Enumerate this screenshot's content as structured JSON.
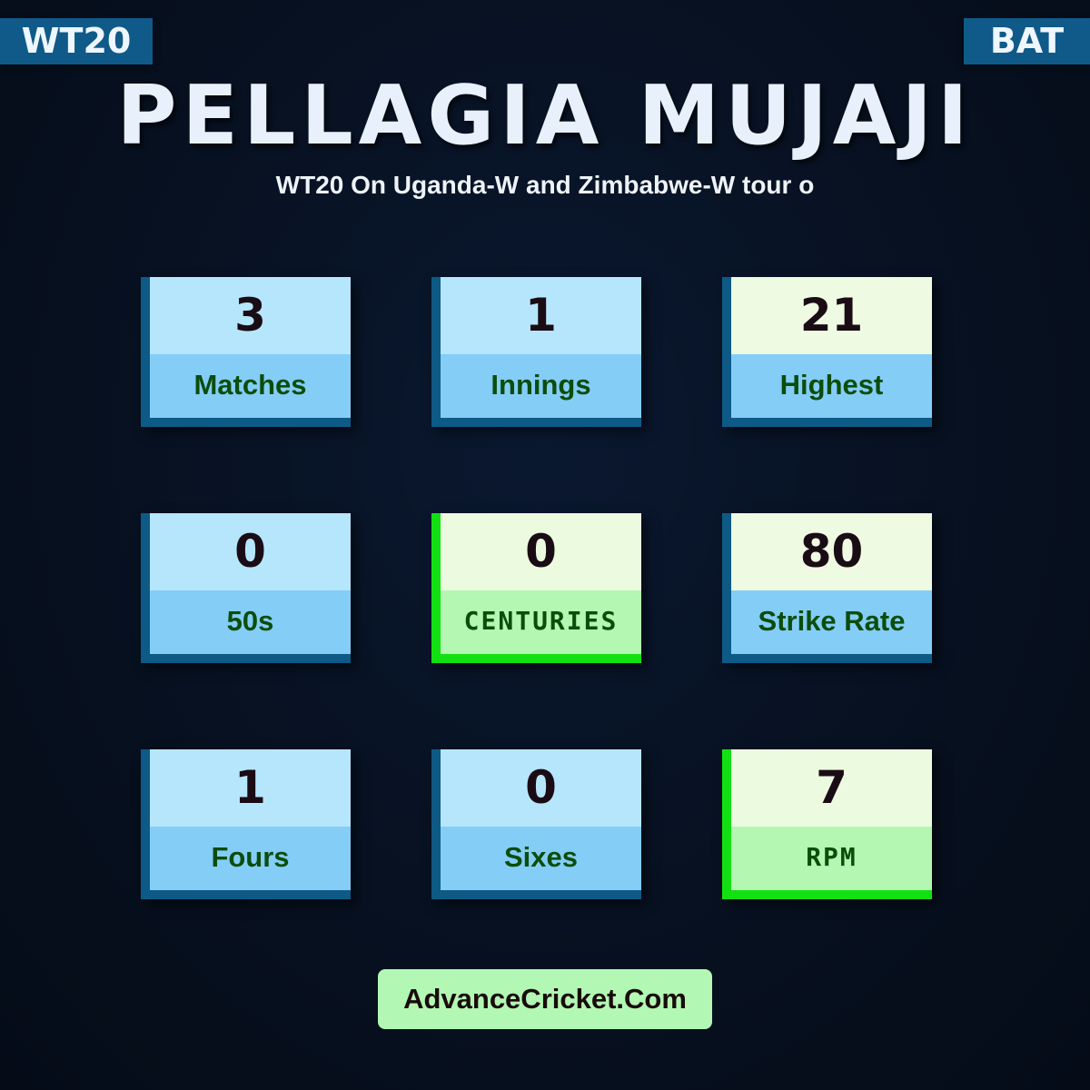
{
  "header": {
    "format_tag": "WT20",
    "role_tag": "BAT",
    "player_name": "PELLAGIA MUJAJI",
    "subtitle": "WT20 On Uganda-W and Zimbabwe-W tour o"
  },
  "stats": [
    {
      "value": "3",
      "label": "Matches",
      "style": "blue"
    },
    {
      "value": "1",
      "label": "Innings",
      "style": "blue"
    },
    {
      "value": "21",
      "label": "Highest",
      "style": "cream"
    },
    {
      "value": "0",
      "label": "50s",
      "style": "blue"
    },
    {
      "value": "0",
      "label": "CENTURIES",
      "style": "green"
    },
    {
      "value": "80",
      "label": "Strike Rate",
      "style": "cream"
    },
    {
      "value": "1",
      "label": "Fours",
      "style": "blue"
    },
    {
      "value": "0",
      "label": "Sixes",
      "style": "blue"
    },
    {
      "value": "7",
      "label": "RPM",
      "style": "green"
    }
  ],
  "footer": {
    "brand": "AdvanceCricket.Com"
  },
  "colors": {
    "background": "#07101f",
    "tag_background": "#0f5a88",
    "card_border_blue": "#0e5a86",
    "card_border_green": "#13e013",
    "label_text": "#0b4d0b",
    "footer_background": "#b2f7b4"
  }
}
